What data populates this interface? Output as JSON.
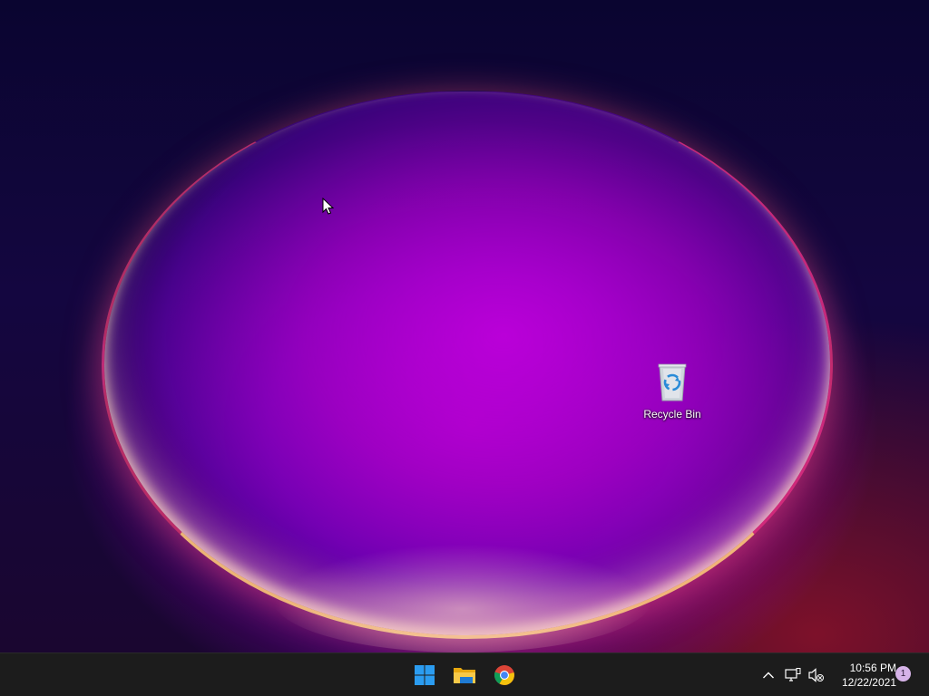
{
  "desktop": {
    "icons": [
      {
        "label": "Recycle Bin",
        "icon": "recycle-bin-icon"
      }
    ]
  },
  "taskbar": {
    "apps": [
      {
        "name": "Start",
        "icon": "windows-start-icon"
      },
      {
        "name": "File Explorer",
        "icon": "file-explorer-icon"
      },
      {
        "name": "Google Chrome",
        "icon": "chrome-icon"
      }
    ],
    "tray": {
      "chevron_icon": "chevron-up-icon",
      "network_icon": "network-icon",
      "volume_icon": "volume-muted-icon",
      "time": "10:56 PM",
      "date": "12/22/2021",
      "notification_count": "1"
    }
  },
  "colors": {
    "taskbar_bg": "#1c1c1c",
    "start_blue": "#2b9cf0",
    "folder_yellow": "#f2bd2a",
    "badge": "#d6b3e8"
  }
}
